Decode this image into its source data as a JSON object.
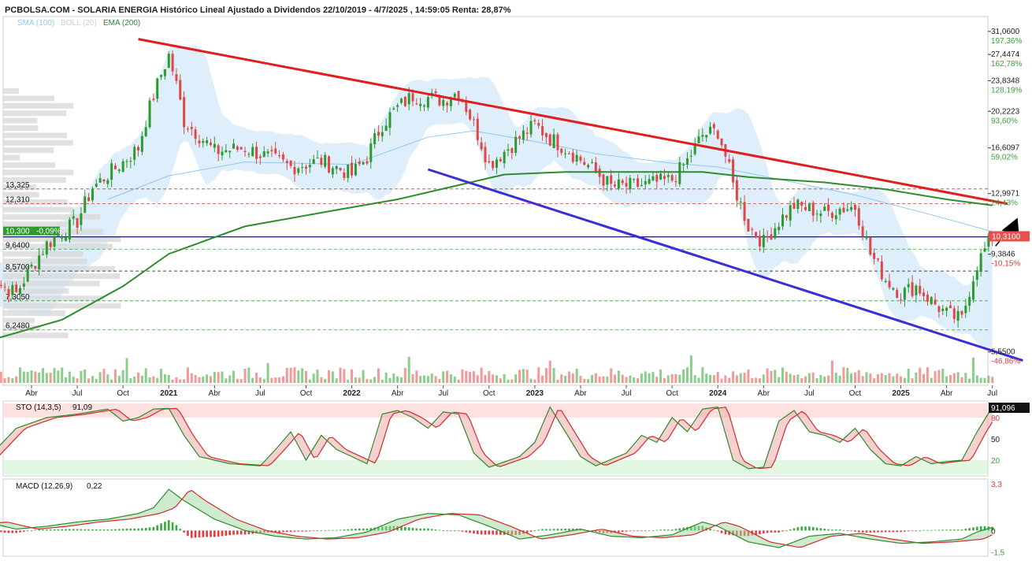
{
  "header": {
    "title": "PCBOLSA.COM - SOLARIA ENERGIA Histórico Lineal Ajustado a Dividendos 22/10/2019 - 4/7/2025 , 14:59:05 Renta: 28,87%",
    "legend": {
      "sma": "SMA (100)",
      "boll": "BOLL (20)",
      "ema": "EMA (200)"
    }
  },
  "colors": {
    "bull": "#2e9a2e",
    "bear": "#e04848",
    "ema": "#2e8b2e",
    "sma": "#8fc8ef",
    "boll_fill": "#d8ecfa",
    "resistance": "#e02020",
    "support": "#3a2fd6",
    "price_tag": "#e85050",
    "overbought": "#fde0e0",
    "oversold": "#e2f8e2"
  },
  "chart_data": [
    {
      "type": "candlestick",
      "id": "price",
      "x_labels": [
        "Abr",
        "Jul",
        "Oct",
        "2021",
        "Abr",
        "Jul",
        "Oct",
        "2022",
        "Abr",
        "Jul",
        "Oct",
        "2023",
        "Abr",
        "Jul",
        "Oct",
        "2024",
        "Abr",
        "Jul",
        "Oct",
        "2025",
        "Abr",
        "Jul"
      ],
      "x_labels_bold": [
        "2021",
        "2022",
        "2023",
        "2024",
        "2025"
      ],
      "y_scale": "log",
      "ylim": [
        4.7,
        33.5
      ],
      "right_ticks": [
        {
          "value": "31,0600",
          "pct": "197,36%"
        },
        {
          "value": "27,4474",
          "pct": "162,78%"
        },
        {
          "value": "23,8348",
          "pct": "128,19%"
        },
        {
          "value": "20,2223",
          "pct": "93,60%"
        },
        {
          "value": "16,6097",
          "pct": "59,02%"
        },
        {
          "value": "12,9971",
          "pct": "24,43%"
        },
        {
          "value": "9,3846",
          "pct": "-10,15%"
        },
        {
          "value": "5,5500",
          "pct": "-46,86%"
        }
      ],
      "current_price": "10,3100",
      "left_levels": [
        {
          "value": "13,325",
          "style": "red-dash"
        },
        {
          "value": "12,310",
          "style": "red-dash"
        },
        {
          "value": "10,300",
          "style": "dark"
        },
        {
          "value": "9,6400",
          "style": "green-dash"
        },
        {
          "value": "8,5700",
          "style": "dark-dash"
        },
        {
          "value": "7,3050",
          "style": "green-dash"
        },
        {
          "value": "6,2480",
          "style": "green-dash"
        }
      ],
      "left_change": "-0,09%",
      "close_points": [
        [
          "2020-01",
          8.3
        ],
        [
          "2020-03",
          7.6
        ],
        [
          "2020-05",
          9.9
        ],
        [
          "2020-07",
          11.2
        ],
        [
          "2020-08",
          13.4
        ],
        [
          "2020-10",
          15.4
        ],
        [
          "2020-11",
          16.6
        ],
        [
          "2020-12",
          22.0
        ],
        [
          "2021-01",
          27.3
        ],
        [
          "2021-02",
          19.2
        ],
        [
          "2021-04",
          16.3
        ],
        [
          "2021-06",
          16.6
        ],
        [
          "2021-09",
          15.0
        ],
        [
          "2021-11",
          15.5
        ],
        [
          "2022-01",
          14.4
        ],
        [
          "2022-02",
          15.8
        ],
        [
          "2022-03",
          18.9
        ],
        [
          "2022-04",
          20.6
        ],
        [
          "2022-05",
          22.0
        ],
        [
          "2022-07",
          21.5
        ],
        [
          "2022-08",
          22.5
        ],
        [
          "2022-09",
          18.8
        ],
        [
          "2022-10",
          15.2
        ],
        [
          "2022-11",
          16.3
        ],
        [
          "2023-01",
          18.8
        ],
        [
          "2023-02",
          17.5
        ],
        [
          "2023-03",
          16.6
        ],
        [
          "2023-05",
          14.6
        ],
        [
          "2023-06",
          13.5
        ],
        [
          "2023-08",
          13.6
        ],
        [
          "2023-10",
          14.0
        ],
        [
          "2023-11",
          15.5
        ],
        [
          "2023-12",
          17.8
        ],
        [
          "2024-01",
          18.2
        ],
        [
          "2024-02",
          13.6
        ],
        [
          "2024-03",
          10.9
        ],
        [
          "2024-04",
          10.0
        ],
        [
          "2024-05",
          11.2
        ],
        [
          "2024-06",
          12.2
        ],
        [
          "2024-08",
          11.7
        ],
        [
          "2024-09",
          12.0
        ],
        [
          "2024-10",
          12.1
        ],
        [
          "2024-11",
          9.4
        ],
        [
          "2024-12",
          8.2
        ],
        [
          "2025-01",
          7.6
        ],
        [
          "2025-02",
          7.9
        ],
        [
          "2025-03",
          7.3
        ],
        [
          "2025-04",
          6.8
        ],
        [
          "2025-05",
          6.6
        ],
        [
          "2025-06",
          8.9
        ],
        [
          "2025-07",
          10.31
        ]
      ],
      "series": [
        {
          "name": "SMA (100)",
          "points": [
            [
              "2020-09",
              12.6
            ],
            [
              "2021-01",
              14.3
            ],
            [
              "2021-06",
              15.4
            ],
            [
              "2022-01",
              15.2
            ],
            [
              "2022-06",
              17.6
            ],
            [
              "2022-09",
              18.2
            ],
            [
              "2023-01",
              17.2
            ],
            [
              "2023-05",
              16.1
            ],
            [
              "2023-10",
              15.3
            ],
            [
              "2024-01",
              15.0
            ],
            [
              "2024-06",
              13.8
            ],
            [
              "2024-10",
              12.9
            ],
            [
              "2025-03",
              11.6
            ],
            [
              "2025-07",
              10.6
            ]
          ]
        },
        {
          "name": "EMA (200)",
          "points": [
            [
              "2019-11",
              5.6
            ],
            [
              "2020-06",
              6.6
            ],
            [
              "2020-10",
              7.9
            ],
            [
              "2021-01",
              9.4
            ],
            [
              "2021-06",
              10.9
            ],
            [
              "2021-12",
              11.9
            ],
            [
              "2022-04",
              12.6
            ],
            [
              "2022-08",
              13.6
            ],
            [
              "2022-11",
              14.4
            ],
            [
              "2023-03",
              14.6
            ],
            [
              "2023-08",
              14.6
            ],
            [
              "2023-12",
              14.6
            ],
            [
              "2024-03",
              14.2
            ],
            [
              "2024-08",
              13.8
            ],
            [
              "2024-12",
              13.3
            ],
            [
              "2025-04",
              12.6
            ],
            [
              "2025-07",
              12.2
            ]
          ]
        }
      ],
      "trendlines": [
        {
          "name": "resistance",
          "from": [
            "2020-11",
            29.8
          ],
          "to": [
            "2025-08",
            12.3
          ]
        },
        {
          "name": "support",
          "from": [
            "2022-06",
            14.8
          ],
          "to": [
            "2025-09",
            5.3
          ]
        }
      ]
    },
    {
      "type": "line",
      "id": "stochastic",
      "label": "STO (14,3,5)",
      "current": "91,09",
      "tag": "91,096",
      "ylim": [
        0,
        100
      ],
      "y_ticks": [
        "80",
        "50",
        "20"
      ],
      "k_points": [
        [
          "2019-11",
          78
        ],
        [
          "2020-01",
          20
        ],
        [
          "2020-03",
          65
        ],
        [
          "2020-05",
          80
        ],
        [
          "2020-07",
          85
        ],
        [
          "2020-09",
          92
        ],
        [
          "2020-10",
          75
        ],
        [
          "2020-11",
          80
        ],
        [
          "2020-12",
          92
        ],
        [
          "2021-01",
          93
        ],
        [
          "2021-02",
          55
        ],
        [
          "2021-03",
          25
        ],
        [
          "2021-05",
          15
        ],
        [
          "2021-07",
          12
        ],
        [
          "2021-08",
          35
        ],
        [
          "2021-09",
          60
        ],
        [
          "2021-10",
          20
        ],
        [
          "2021-11",
          55
        ],
        [
          "2021-12",
          35
        ],
        [
          "2022-02",
          15
        ],
        [
          "2022-03",
          85
        ],
        [
          "2022-04",
          90
        ],
        [
          "2022-05",
          80
        ],
        [
          "2022-06",
          65
        ],
        [
          "2022-07",
          88
        ],
        [
          "2022-08",
          85
        ],
        [
          "2022-09",
          30
        ],
        [
          "2022-10",
          10
        ],
        [
          "2022-12",
          25
        ],
        [
          "2023-01",
          45
        ],
        [
          "2023-02",
          95
        ],
        [
          "2023-03",
          60
        ],
        [
          "2023-04",
          25
        ],
        [
          "2023-05",
          12
        ],
        [
          "2023-07",
          30
        ],
        [
          "2023-08",
          55
        ],
        [
          "2023-09",
          45
        ],
        [
          "2023-10",
          80
        ],
        [
          "2023-11",
          60
        ],
        [
          "2023-12",
          92
        ],
        [
          "2024-01",
          95
        ],
        [
          "2024-02",
          20
        ],
        [
          "2024-03",
          8
        ],
        [
          "2024-04",
          10
        ],
        [
          "2024-05",
          75
        ],
        [
          "2024-06",
          90
        ],
        [
          "2024-07",
          60
        ],
        [
          "2024-08",
          55
        ],
        [
          "2024-09",
          45
        ],
        [
          "2024-10",
          65
        ],
        [
          "2024-11",
          35
        ],
        [
          "2024-12",
          15
        ],
        [
          "2025-01",
          12
        ],
        [
          "2025-02",
          25
        ],
        [
          "2025-03",
          15
        ],
        [
          "2025-04",
          18
        ],
        [
          "2025-05",
          20
        ],
        [
          "2025-06",
          60
        ],
        [
          "2025-07",
          95
        ]
      ]
    },
    {
      "type": "line",
      "id": "macd",
      "label": "MACD (12,26,9)",
      "current": "0,22",
      "ylim": [
        -1.7,
        3.4
      ],
      "y_ticks": [
        "3,3",
        "0",
        "-1,5"
      ],
      "macd_points": [
        [
          "2019-11",
          0.4
        ],
        [
          "2020-01",
          0.6
        ],
        [
          "2020-03",
          0.1
        ],
        [
          "2020-05",
          0.3
        ],
        [
          "2020-07",
          0.6
        ],
        [
          "2020-09",
          0.8
        ],
        [
          "2020-11",
          1.2
        ],
        [
          "2020-12",
          1.6
        ],
        [
          "2021-01",
          2.9
        ],
        [
          "2021-02",
          2.1
        ],
        [
          "2021-04",
          0.8
        ],
        [
          "2021-06",
          0.0
        ],
        [
          "2021-08",
          -0.4
        ],
        [
          "2021-10",
          -0.6
        ],
        [
          "2021-12",
          -0.5
        ],
        [
          "2022-02",
          -0.1
        ],
        [
          "2022-04",
          0.8
        ],
        [
          "2022-06",
          1.2
        ],
        [
          "2022-08",
          1.1
        ],
        [
          "2022-10",
          0.3
        ],
        [
          "2022-12",
          -0.6
        ],
        [
          "2023-02",
          -0.3
        ],
        [
          "2023-04",
          0.1
        ],
        [
          "2023-06",
          -0.4
        ],
        [
          "2023-08",
          -0.5
        ],
        [
          "2023-10",
          -0.3
        ],
        [
          "2023-12",
          0.6
        ],
        [
          "2024-01",
          0.3
        ],
        [
          "2024-03",
          -0.8
        ],
        [
          "2024-05",
          -1.2
        ],
        [
          "2024-07",
          -0.4
        ],
        [
          "2024-09",
          -0.2
        ],
        [
          "2024-11",
          -0.6
        ],
        [
          "2025-01",
          -0.9
        ],
        [
          "2025-03",
          -0.8
        ],
        [
          "2025-05",
          -0.6
        ],
        [
          "2025-06",
          -0.1
        ],
        [
          "2025-07",
          0.22
        ]
      ]
    }
  ]
}
